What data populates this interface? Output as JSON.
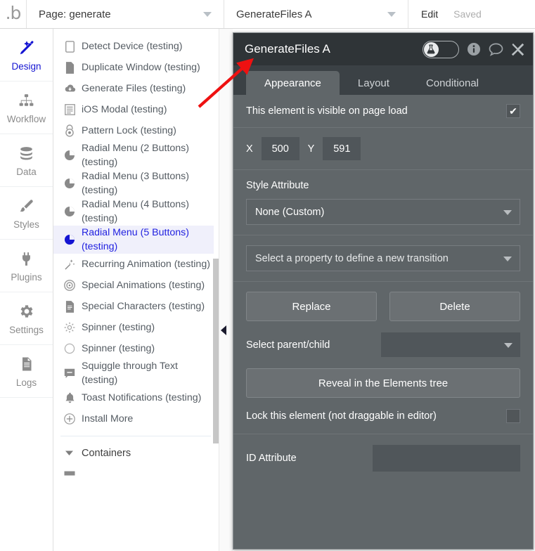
{
  "topbar": {
    "logo": "bubble-logo",
    "page_label": "Page: generate",
    "element_label": "GenerateFiles A",
    "edit_label": "Edit",
    "saved_label": "Saved"
  },
  "rail": {
    "items": [
      {
        "label": "Design",
        "icon": "design-icon",
        "active": true
      },
      {
        "label": "Workflow",
        "icon": "workflow-icon",
        "active": false
      },
      {
        "label": "Data",
        "icon": "data-icon",
        "active": false
      },
      {
        "label": "Styles",
        "icon": "styles-icon",
        "active": false
      },
      {
        "label": "Plugins",
        "icon": "plugins-icon",
        "active": false
      },
      {
        "label": "Settings",
        "icon": "settings-icon",
        "active": false
      },
      {
        "label": "Logs",
        "icon": "logs-icon",
        "active": false
      }
    ]
  },
  "element_list": {
    "items": [
      {
        "label": "Detect Device (testing)",
        "icon": "device-icon",
        "selected": false
      },
      {
        "label": "Duplicate Window (testing)",
        "icon": "document-icon",
        "selected": false
      },
      {
        "label": "Generate Files (testing)",
        "icon": "cloud-download-icon",
        "selected": false
      },
      {
        "label": "iOS Modal (testing)",
        "icon": "modal-list-icon",
        "selected": false
      },
      {
        "label": "Pattern Lock (testing)",
        "icon": "lock-icon",
        "selected": false
      },
      {
        "label": "Radial Menu (2 Buttons) (testing)",
        "icon": "radial-menu-icon",
        "selected": false
      },
      {
        "label": "Radial Menu (3 Buttons) (testing)",
        "icon": "radial-menu-icon",
        "selected": false
      },
      {
        "label": "Radial Menu (4 Buttons) (testing)",
        "icon": "radial-menu-icon",
        "selected": false
      },
      {
        "label": "Radial Menu (5 Buttons) (testing)",
        "icon": "radial-menu-icon",
        "selected": true
      },
      {
        "label": "Recurring Animation (testing)",
        "icon": "magic-wand-icon",
        "selected": false
      },
      {
        "label": "Special Animations (testing)",
        "icon": "target-circle-icon",
        "selected": false
      },
      {
        "label": "Special Characters (testing)",
        "icon": "document-icon",
        "selected": false
      },
      {
        "label": "Spinner (testing)",
        "icon": "spinner-sun-icon",
        "selected": false
      },
      {
        "label": "Spinner (testing)",
        "icon": "spinner-circle-icon",
        "selected": false
      },
      {
        "label": "Squiggle through Text (testing)",
        "icon": "speech-square-icon",
        "selected": false
      },
      {
        "label": "Toast Notifications (testing)",
        "icon": "bell-icon",
        "selected": false
      },
      {
        "label": "Install More",
        "icon": "plus-circle-icon",
        "selected": false
      }
    ],
    "group_label": "Containers",
    "collapse_arrow": "collapse-panel-arrow"
  },
  "property_panel": {
    "title": "GenerateFiles A",
    "header_icons": {
      "toggle": "flask-toggle",
      "info": "info-icon",
      "comment": "comment-icon",
      "close": "close-icon"
    },
    "tabs": [
      {
        "label": "Appearance",
        "active": true
      },
      {
        "label": "Layout",
        "active": false
      },
      {
        "label": "Conditional",
        "active": false
      }
    ],
    "visible_on_load": {
      "label": "This element is visible on page load",
      "checked": true,
      "check_glyph": "✔"
    },
    "position": {
      "x_label": "X",
      "x_value": "500",
      "y_label": "Y",
      "y_value": "591"
    },
    "style_attribute": {
      "label": "Style Attribute",
      "value": "None (Custom)"
    },
    "transition": {
      "value": "Select a property to define a new transition"
    },
    "buttons": {
      "replace": "Replace",
      "delete": "Delete",
      "reveal": "Reveal in the Elements tree"
    },
    "parent_child": {
      "label": "Select parent/child",
      "value": ""
    },
    "lock": {
      "label": "Lock this element (not draggable in editor)",
      "checked": false
    },
    "id_attribute": {
      "label": "ID Attribute",
      "value": ""
    }
  },
  "annotation": {
    "arrow_color": "#ee1111",
    "name": "red-pointer-arrow"
  }
}
